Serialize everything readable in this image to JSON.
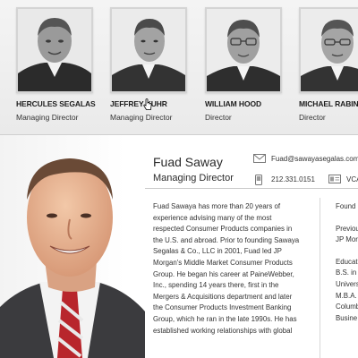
{
  "team": [
    {
      "name": "HERCULES SEGALAS",
      "title": "Managing Director"
    },
    {
      "name": "JEFFREY KUHR",
      "title": "Managing Director"
    },
    {
      "name": "WILLIAM HOOD",
      "title": "Director"
    },
    {
      "name": "MICHAEL RABIN",
      "title": "Director"
    }
  ],
  "profile": {
    "name": "Fuad Saway",
    "title": "Managing Director",
    "email": "Fuad@sawayasegalas.com",
    "phone": "212.331.0151",
    "vcard": "VCA",
    "bio_lines": [
      "Fuad Sawaya has more than 20 years of",
      "experience advising many of the most",
      "respected Consumer Products companies in",
      "the U.S. and abroad. Prior to founding Sawaya",
      "Segalas & Co., LLC in 2001, Fuad led JP",
      "Morgan's Middle Market Consumer Products",
      "Group. He began his career at PaineWebber,",
      "Inc., spending 14 years there, first in the",
      "Mergers & Acquisitions department and later",
      "the Consumer Products Investment Banking",
      "Group, which he ran in the late 1990s. He has",
      "established working relationships with global"
    ],
    "side_top": "Found",
    "side_mid": [
      "Previou",
      "JP Mor"
    ],
    "side_bottom": [
      "Educat",
      "B.S. in",
      "Univers",
      "M.B.A.",
      "Columb",
      "Busine"
    ]
  },
  "colors": {
    "strip_bg": "#eeeeee",
    "text": "#333333",
    "tie_red": "#b8262c"
  },
  "icons": {
    "email": "envelope-icon",
    "phone": "phone-icon",
    "vcard": "vcard-icon",
    "cursor": "hand-cursor-icon"
  }
}
